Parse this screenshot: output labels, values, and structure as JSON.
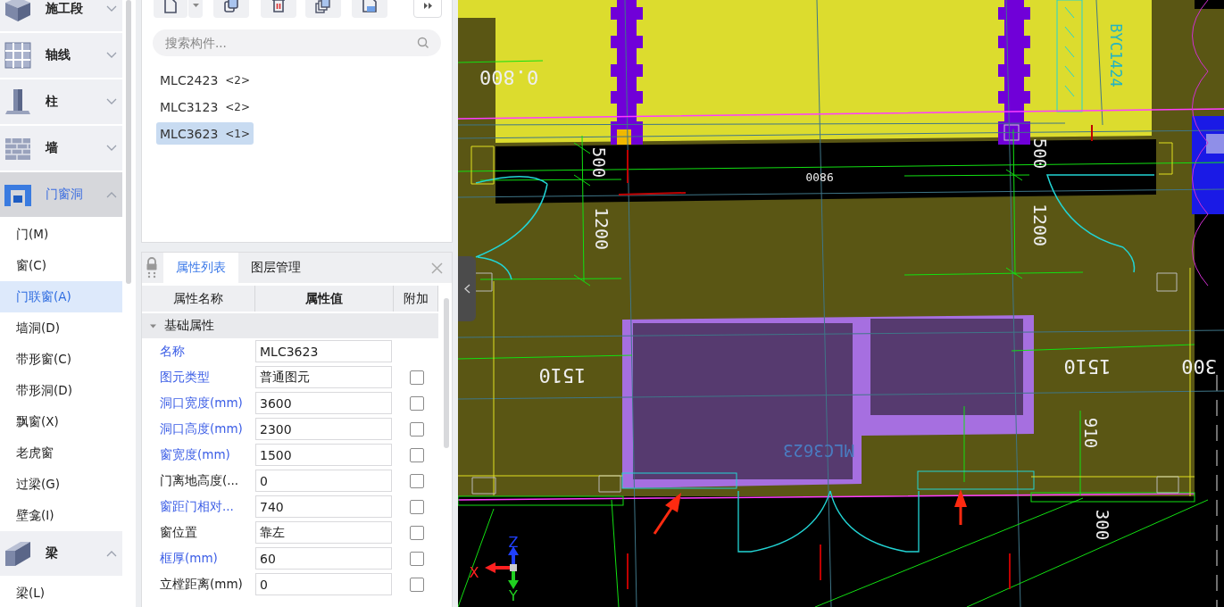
{
  "sidebar": {
    "categories": [
      {
        "label": "施工段",
        "expanded": false,
        "selected": false
      },
      {
        "label": "轴线",
        "expanded": false,
        "selected": false
      },
      {
        "label": "柱",
        "expanded": false,
        "selected": false
      },
      {
        "label": "墙",
        "expanded": false,
        "selected": false
      },
      {
        "label": "门窗洞",
        "expanded": true,
        "selected": true,
        "items": [
          {
            "label": "门(M)",
            "selected": false
          },
          {
            "label": "窗(C)",
            "selected": false
          },
          {
            "label": "门联窗(A)",
            "selected": true
          },
          {
            "label": "墙洞(D)",
            "selected": false
          },
          {
            "label": "带形窗(C)",
            "selected": false
          },
          {
            "label": "带形洞(D)",
            "selected": false
          },
          {
            "label": "飘窗(X)",
            "selected": false
          },
          {
            "label": "老虎窗",
            "selected": false
          },
          {
            "label": "过梁(G)",
            "selected": false
          },
          {
            "label": "壁龛(I)",
            "selected": false
          }
        ]
      },
      {
        "label": "梁",
        "expanded": true,
        "selected": false,
        "items": [
          {
            "label": "梁(L)",
            "selected": false
          }
        ]
      }
    ]
  },
  "search": {
    "placeholder": "搜索构件..."
  },
  "components": [
    {
      "name": "MLC2423",
      "count": "<2>",
      "selected": false
    },
    {
      "name": "MLC3123",
      "count": "<2>",
      "selected": false
    },
    {
      "name": "MLC3623",
      "count": "<1>",
      "selected": true
    }
  ],
  "properties_panel": {
    "tabs": [
      {
        "label": "属性列表",
        "selected": true
      },
      {
        "label": "图层管理",
        "selected": false
      }
    ],
    "columns": [
      "属性名称",
      "属性值",
      "附加"
    ],
    "group": {
      "label": "基础属性",
      "expanded": true
    },
    "rows": [
      {
        "name": "名称",
        "value": "MLC3623",
        "public": true
      },
      {
        "name": "图元类型",
        "value": "普通图元",
        "public": true,
        "checked": false
      },
      {
        "name": "洞口宽度(mm)",
        "value": "3600",
        "public": true,
        "checked": false
      },
      {
        "name": "洞口高度(mm)",
        "value": "2300",
        "public": true,
        "checked": false
      },
      {
        "name": "窗宽度(mm)",
        "value": "1500",
        "public": true,
        "checked": false
      },
      {
        "name": "门离地高度(...",
        "value": "0",
        "public": false,
        "checked": false
      },
      {
        "name": "窗距门相对...",
        "value": "740",
        "public": true,
        "checked": false
      },
      {
        "name": "窗位置",
        "value": "靠左",
        "public": false,
        "checked": false
      },
      {
        "name": "框厚(mm)",
        "value": "60",
        "public": true,
        "checked": false
      },
      {
        "name": "立樘距离(mm)",
        "value": "0",
        "public": false,
        "checked": false
      }
    ]
  },
  "canvas": {
    "labels": [
      "0.800",
      "9800",
      "500",
      "1200",
      "500",
      "1200",
      "BYC1424",
      "1510",
      "1510",
      "300",
      "910",
      "300",
      "MLC3623"
    ],
    "axes": [
      "X",
      "Y",
      "Z"
    ]
  }
}
